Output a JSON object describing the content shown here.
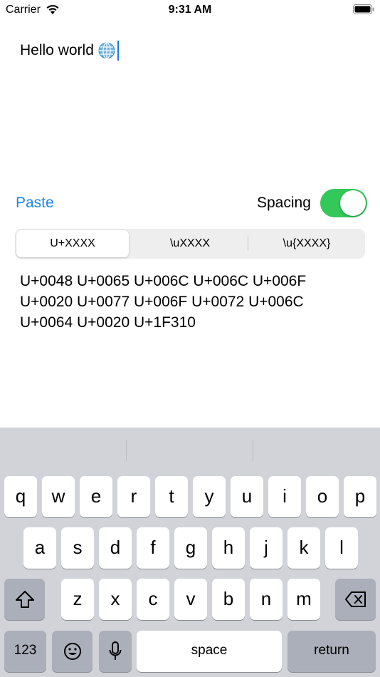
{
  "status_bar": {
    "carrier": "Carrier",
    "time": "9:31 AM"
  },
  "input": {
    "text": "Hello world",
    "icon": "globe-icon"
  },
  "controls": {
    "paste_label": "Paste",
    "spacing_label": "Spacing",
    "spacing_on": true,
    "toggle_color": "#34c759"
  },
  "segments": {
    "items": [
      "U+XXXX",
      "\\uXXXX",
      "\\u{XXXX}"
    ],
    "selected": "U+XXXX"
  },
  "output": {
    "line1": "U+0048 U+0065 U+006C U+006C U+006F",
    "line2": "U+0020 U+0077 U+006F U+0072 U+006C",
    "line3": "U+0064 U+0020 U+1F310"
  },
  "keyboard": {
    "row1": [
      "q",
      "w",
      "e",
      "r",
      "t",
      "y",
      "u",
      "i",
      "o",
      "p"
    ],
    "row2": [
      "a",
      "s",
      "d",
      "f",
      "g",
      "h",
      "j",
      "k",
      "l"
    ],
    "row3": [
      "z",
      "x",
      "c",
      "v",
      "b",
      "n",
      "m"
    ],
    "numbers_label": "123",
    "space_label": "space",
    "return_label": "return"
  }
}
